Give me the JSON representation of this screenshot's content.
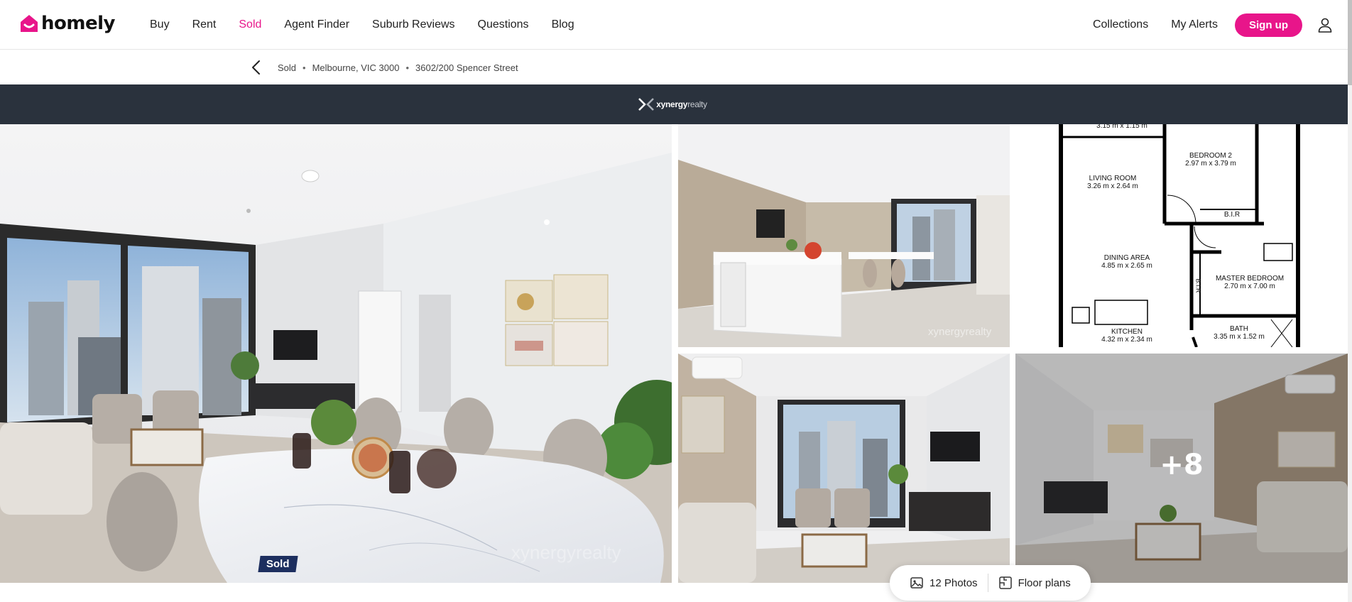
{
  "brand": {
    "name": "homely",
    "accent": "#e8158a"
  },
  "nav": {
    "links": [
      "Buy",
      "Rent",
      "Sold",
      "Agent Finder",
      "Suburb Reviews",
      "Questions",
      "Blog"
    ],
    "active": "Sold",
    "right": {
      "collections": "Collections",
      "alerts": "My Alerts",
      "signup": "Sign up"
    },
    "user_icon": "user-icon"
  },
  "breadcrumb": {
    "back_icon": "chevron-left-icon",
    "items": [
      "Sold",
      "Melbourne, VIC 3000",
      "3602/200 Spencer Street"
    ]
  },
  "agency": {
    "name_bold": "xynergy",
    "name_light": "realty",
    "bar_color": "#2a323d"
  },
  "gallery": {
    "badge": "Sold",
    "more_count": "+8",
    "floorplan_labels": {
      "top": "3.15 m x 1.15 m",
      "bedroom2": "BEDROOM 2",
      "bedroom2_size": "2.97 m x 3.79 m",
      "living": "LIVING ROOM",
      "living_size": "3.26 m x 2.64 m",
      "bir1": "B.I.R",
      "dining": "DINING AREA",
      "dining_size": "4.85 m x 2.65 m",
      "bir2": "B.I.R",
      "master": "MASTER BEDROOM",
      "master_size": "2.70 m x 7.00 m",
      "kitchen": "KITCHEN",
      "kitchen_size": "4.32 m x 2.34 m",
      "bath": "BATH",
      "bath_size": "3.35 m x 1.52 m"
    }
  },
  "media_pill": {
    "photos": "12 Photos",
    "floorplans": "Floor plans"
  }
}
